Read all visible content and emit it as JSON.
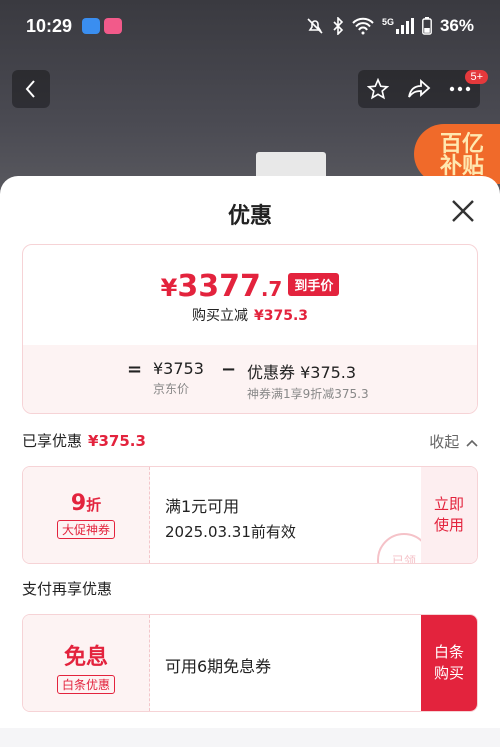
{
  "status": {
    "time": "10:29",
    "battery": "36%",
    "network": "5G"
  },
  "topnav": {
    "badge": "5+"
  },
  "background": {
    "promo_text": "百亿\n补贴"
  },
  "sheet": {
    "title": "优惠",
    "price": {
      "yen": "¥",
      "int": "3377",
      "dec": ".7",
      "tag": "到手价",
      "sub_label": "购买立减",
      "sub_value": "¥375.3"
    },
    "formula": {
      "eq": "=",
      "base_value": "¥3753",
      "base_label": "京东价",
      "minus": "−",
      "coupon_value": "优惠券 ¥375.3",
      "coupon_label": "神券满1享9折减375.3"
    },
    "enjoyed": {
      "label": "已享优惠",
      "value": "¥375.3",
      "collapse": "收起"
    },
    "coupon1": {
      "big": "9",
      "big_unit": "折",
      "tag": "大促神券",
      "title": "满1元可用",
      "valid": "2025.03.31前有效",
      "action": "立即\n使用",
      "stamp": "已领"
    },
    "pay_section": "支付再享优惠",
    "coupon2": {
      "big": "免息",
      "tag": "白条优惠",
      "title": "可用6期免息券",
      "action": "白条\n购买"
    }
  },
  "colors": {
    "accent": "#e3233d"
  }
}
